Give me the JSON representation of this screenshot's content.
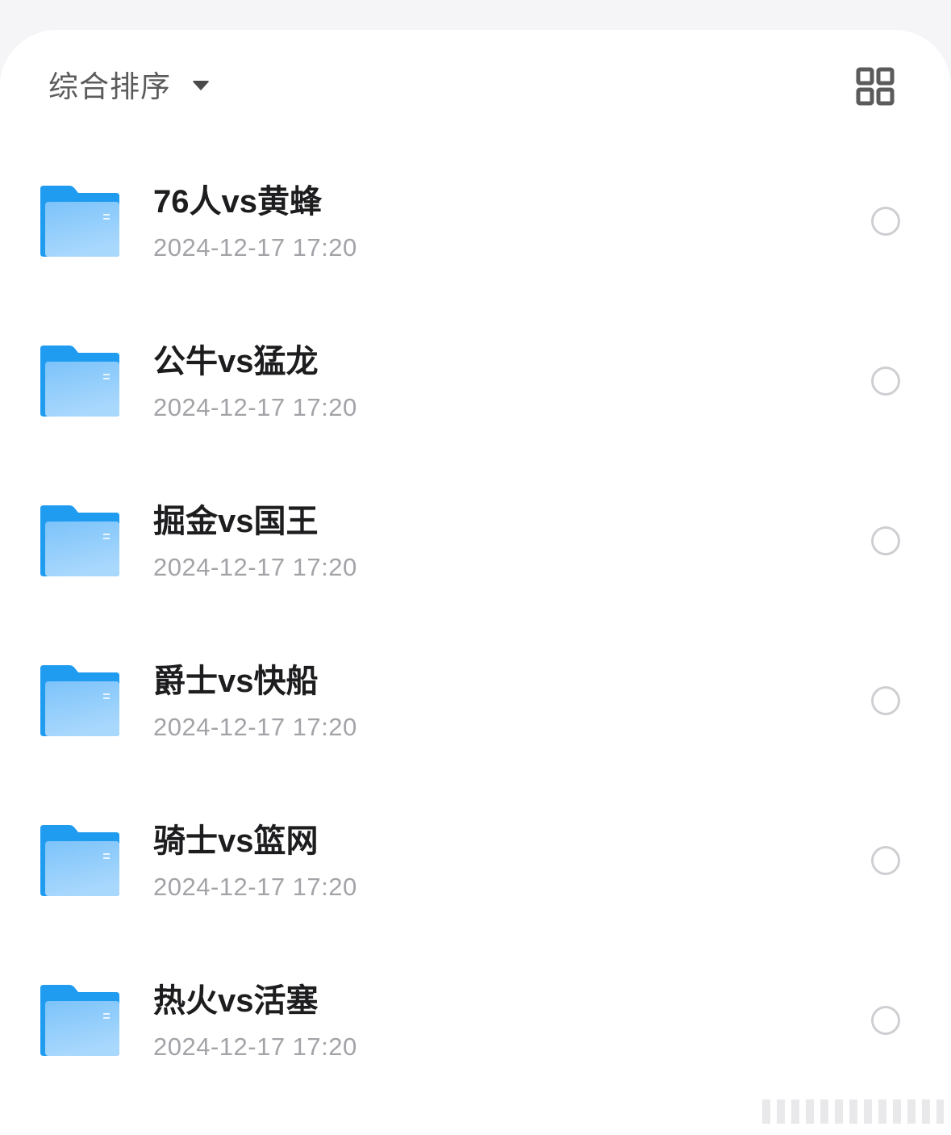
{
  "toolbar": {
    "sort_label": "综合排序",
    "sort_icon": "caret-down-icon",
    "view_toggle_icon": "grid-view-icon"
  },
  "colors": {
    "folder_dark": "#1f9bf0",
    "folder_light": "#8ccafb",
    "text_primary": "#1d1d1f",
    "text_secondary": "#a3a3a8",
    "radio_border": "#cfcfd3",
    "icon_gray": "#5b5b5b"
  },
  "files": [
    {
      "name": "76人vs黄蜂",
      "date": "2024-12-17 17:20",
      "icon": "folder-icon"
    },
    {
      "name": "公牛vs猛龙",
      "date": "2024-12-17 17:20",
      "icon": "folder-icon"
    },
    {
      "name": "掘金vs国王",
      "date": "2024-12-17 17:20",
      "icon": "folder-icon"
    },
    {
      "name": "爵士vs快船",
      "date": "2024-12-17 17:20",
      "icon": "folder-icon"
    },
    {
      "name": "骑士vs篮网",
      "date": "2024-12-17 17:20",
      "icon": "folder-icon"
    },
    {
      "name": "热火vs活塞",
      "date": "2024-12-17 17:20",
      "icon": "folder-icon"
    }
  ]
}
